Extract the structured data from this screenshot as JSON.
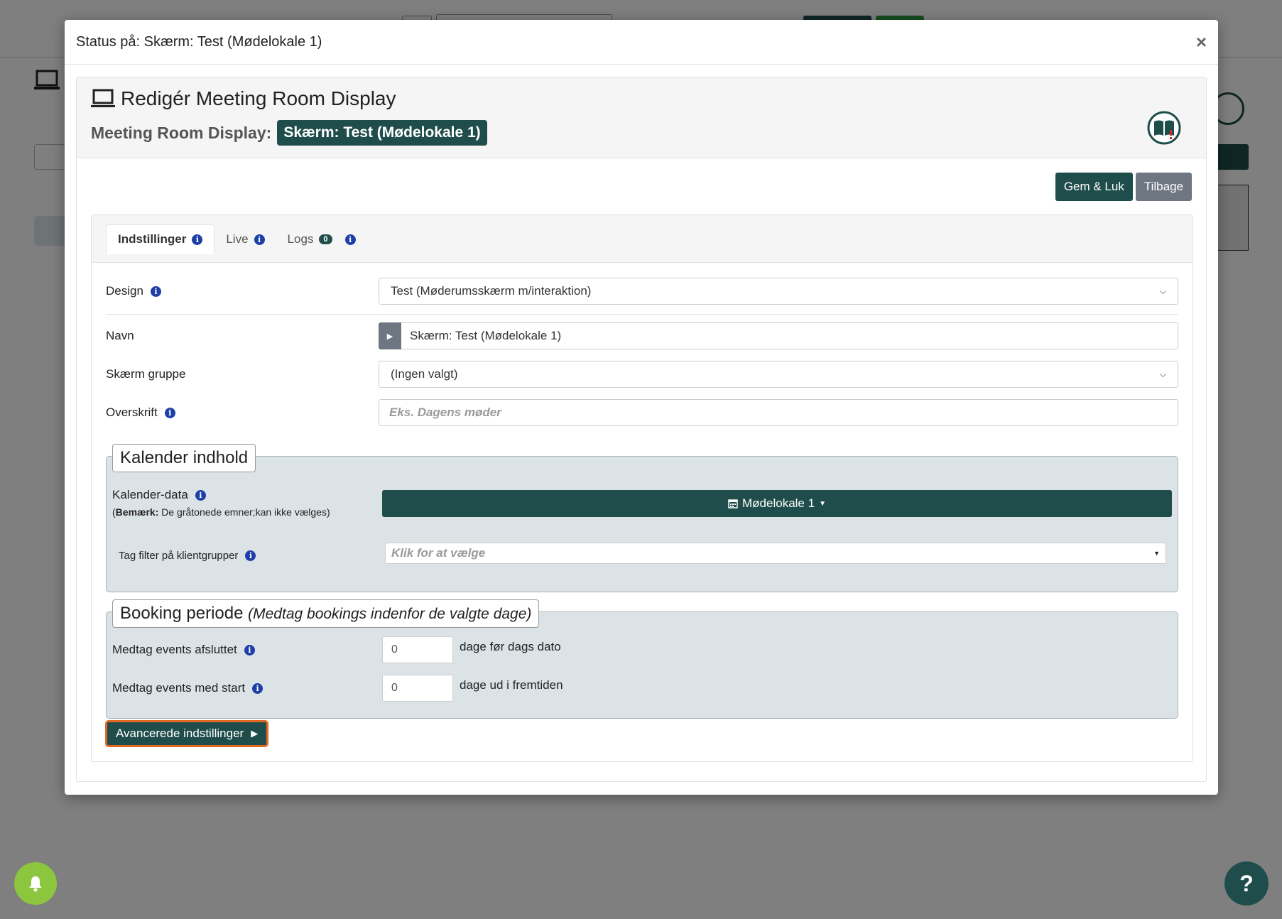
{
  "modal": {
    "title": "Status på: Skærm: Test (Mødelokale 1)",
    "close_label": "×"
  },
  "card": {
    "heading": "Redigér Meeting Room Display",
    "subtitle_label": "Meeting Room Display:",
    "subtitle_badge": "Skærm: Test (Mødelokale 1)"
  },
  "actions": {
    "save_close": "Gem & Luk",
    "back": "Tilbage"
  },
  "tabs": [
    {
      "label": "Indstillinger",
      "active": true
    },
    {
      "label": "Live",
      "active": false
    },
    {
      "label": "Logs",
      "count": "0",
      "active": false
    }
  ],
  "form": {
    "design_label": "Design",
    "design_value": "Test (Møderumsskærm m/interaktion)",
    "name_label": "Navn",
    "name_value": "Skærm: Test (Mødelokale 1)",
    "group_label": "Skærm gruppe",
    "group_value": "(Ingen valgt)",
    "heading_label": "Overskrift",
    "heading_placeholder": "Eks. Dagens møder"
  },
  "calendar": {
    "legend": "Kalender indhold",
    "data_label": "Kalender-data",
    "note_bold": "Bemærk:",
    "note_text": "De gråtonede emner;kan ikke vælges)",
    "note_open": "(",
    "calendar_button": "Mødelokale 1",
    "tag_filter_label": "Tag filter på klientgrupper",
    "tag_filter_placeholder": "Klik for at vælge"
  },
  "booking": {
    "legend": "Booking periode",
    "legend_note": "(Medtag bookings indenfor de valgte dage)",
    "ended_label": "Medtag events afsluttet",
    "ended_value": "0",
    "ended_suffix": "dage før dags dato",
    "start_label": "Medtag events med start",
    "start_value": "0",
    "start_suffix": "dage ud i fremtiden"
  },
  "advanced_button": "Avancerede indstillinger",
  "help_label": "?",
  "colors": {
    "primary": "#1f4d4b",
    "secondary": "#6e7681",
    "info": "#1e3fa8",
    "bell": "#8cc63f",
    "focus_outline": "#e06820"
  },
  "icons": [
    "close-icon",
    "laptop-icon",
    "book-icon",
    "info-icon",
    "caret-right-icon",
    "chevron-down-icon",
    "calendar-icon",
    "bell-icon",
    "help-icon"
  ]
}
